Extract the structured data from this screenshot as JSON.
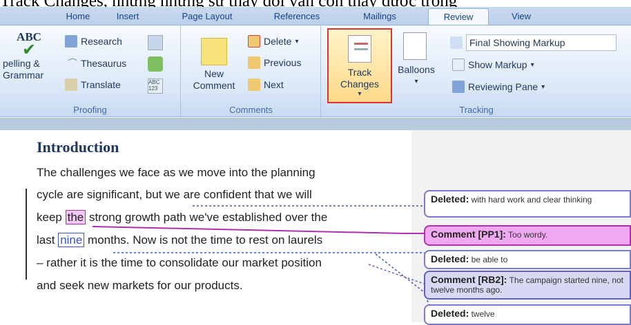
{
  "caption": "Track Changes, nhưng những sự thay đổi vẫn còn thấy được trong",
  "tabs": [
    "Home",
    "Insert",
    "Page Layout",
    "References",
    "Mailings",
    "Review",
    "View"
  ],
  "active_tab": "Review",
  "proofing": {
    "spelling_top": "ABC",
    "spelling_label": "pelling & Grammar",
    "research": "Research",
    "thesaurus": "Thesaurus",
    "translate": "Translate",
    "label": "Proofing"
  },
  "comments": {
    "new_comment": "New Comment",
    "delete": "Delete",
    "previous": "Previous",
    "next": "Next",
    "label": "Comments"
  },
  "tracking": {
    "track_changes": "Track Changes",
    "balloons": "Balloons",
    "display_select": "Final Showing Markup",
    "show_markup": "Show Markup",
    "reviewing_pane": "Reviewing Pane",
    "label": "Tracking"
  },
  "document": {
    "heading": "Introduction",
    "line1": "The challenges we face as we move into the planning",
    "line2": "cycle are significant, but we are confident that we will",
    "line3_pre": "keep ",
    "line3_ins": "the",
    "line3_post": " strong growth path we've established over the",
    "line4_pre": "last ",
    "line4_ins": "nine",
    "line4_post": " months.  Now is not the time to rest on laurels",
    "line5": "– rather it is the time to consolidate our market position",
    "line6": "and seek new markets for our products."
  },
  "balloons": [
    {
      "title": "Deleted:",
      "text": "with hard work and clear thinking"
    },
    {
      "title": "Comment [PP1]:",
      "text": "Too wordy."
    },
    {
      "title": "Deleted:",
      "text": "be able to"
    },
    {
      "title": "Comment [RB2]:",
      "text": "The campaign started nine,  not twelve months ago."
    },
    {
      "title": "Deleted:",
      "text": "twelve"
    }
  ]
}
